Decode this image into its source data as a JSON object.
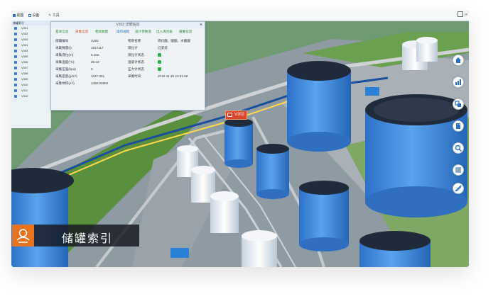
{
  "menu": {
    "items": [
      {
        "icon": "grid-icon",
        "label": "视图"
      },
      {
        "icon": "device-icon",
        "label": "设备"
      },
      {
        "icon": "tool-icon",
        "label": "工具"
      }
    ],
    "right_label": "20"
  },
  "tree": {
    "header": "储罐索引",
    "items": [
      "V301",
      "V302",
      "V303",
      "V301",
      "V304",
      "V305",
      "V306",
      "V307",
      "V308",
      "V309",
      "V310",
      "V311",
      "V312"
    ]
  },
  "panel": {
    "title": "V302 详细信息",
    "close_label": "×",
    "tabs": [
      {
        "label": "基本信息",
        "state": "normal"
      },
      {
        "label": "采集信息",
        "state": "active"
      },
      {
        "label": "物资数量",
        "state": "normal"
      },
      {
        "label": "操作规程",
        "state": "blue"
      },
      {
        "label": "设计参数值",
        "state": "normal"
      },
      {
        "label": "出入库台账",
        "state": "normal"
      },
      {
        "label": "报警信息",
        "state": "normal"
      }
    ],
    "rows": [
      {
        "label": "储罐编号",
        "value": "V302",
        "label2": "物资名称",
        "value2": "液化酸，酸酸，水酸酸"
      },
      {
        "label": "采集数量(t)",
        "value": "1517117",
        "label2": "液位计",
        "value2": "已安装"
      },
      {
        "label": "采集液位(m)",
        "value": "5.342",
        "label2": "液位计状态",
        "value2": ""
      },
      {
        "label": "采集温度(°C)",
        "value": "25.43",
        "label2": "温度计状态",
        "value2": ""
      },
      {
        "label": "采集压强(kpa)",
        "value": "0",
        "label2": "压力计状态",
        "value2": ""
      },
      {
        "label": "采集密度(g/m³)",
        "value": "1047.001",
        "label2": "采集时间",
        "value2": "2018-11-30 23:51:58"
      },
      {
        "label": "采集体积(m³)",
        "value": "1450.03882",
        "label2": "",
        "value2": ""
      }
    ]
  },
  "tank_tag": {
    "label": "V302"
  },
  "right_tools": [
    {
      "name": "home-icon"
    },
    {
      "name": "chart-icon"
    },
    {
      "name": "layers-icon"
    },
    {
      "name": "building-icon"
    },
    {
      "name": "search-icon"
    },
    {
      "name": "list-icon"
    },
    {
      "name": "measure-icon"
    }
  ],
  "caption": {
    "text": "储罐索引",
    "icon": "tank-index-icon"
  },
  "colors": {
    "accent": "#e8731f",
    "tab_active": "#d04a2a",
    "tab_normal": "#2d8a3a",
    "status_on": "#27b24a",
    "tag": "#d9462c"
  }
}
